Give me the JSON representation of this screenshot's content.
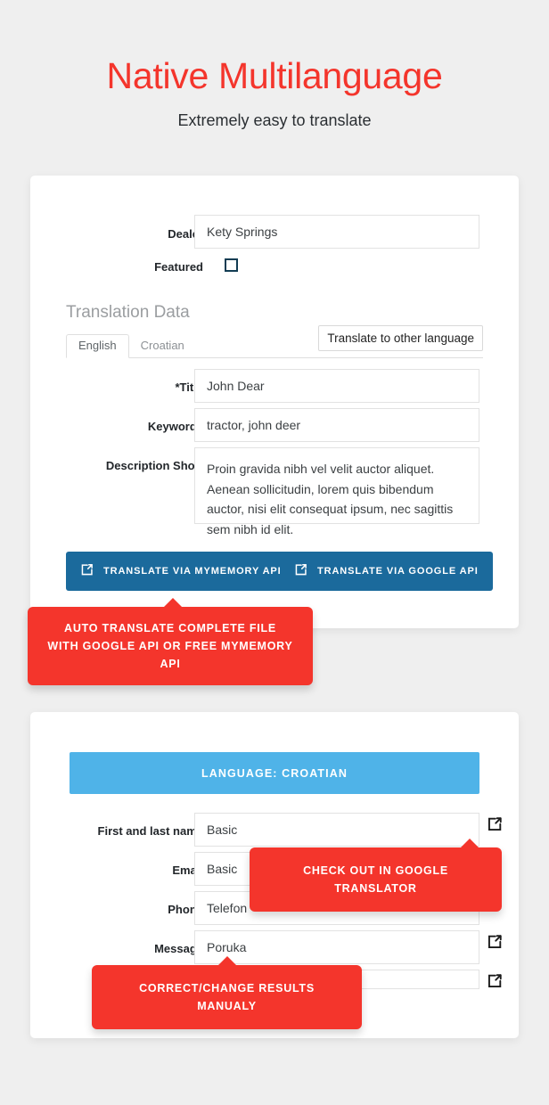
{
  "header": {
    "title": "Native Multilanguage",
    "subtitle": "Extremely easy to translate",
    "title_color": "#f4352c"
  },
  "colors": {
    "page_background": "#efefef",
    "accent_red": "#f4352c",
    "button_blue": "#1b6a9c",
    "banner_blue": "#4fb3e8",
    "card_white": "#ffffff"
  },
  "translation_card": {
    "fields": [
      {
        "label": "Dealer",
        "value": "Kety Springs",
        "type": "text"
      },
      {
        "label": "Featured",
        "value": "",
        "type": "checkbox",
        "checked": false
      }
    ],
    "section_heading": "Translation Data",
    "tabs": [
      {
        "label": "English",
        "active": true
      },
      {
        "label": "Croatian",
        "active": false
      }
    ],
    "translate_other_language_button": "Translate to other language",
    "translation_fields": [
      {
        "label": "*Title",
        "value": "John Dear"
      },
      {
        "label": "Keywords",
        "value": "tractor, john deer"
      },
      {
        "label": "Description Short",
        "value": "Proin gravida nibh vel velit auctor aliquet. Aenean sollicitudin, lorem quis bibendum auctor, nisi elit consequat ipsum, nec sagittis sem nibh id elit."
      }
    ],
    "buttons": [
      {
        "label": "TRANSLATE VIA MYMEMORY API",
        "icon": "external-link-icon"
      },
      {
        "label": "TRANSLATE VIA GOOGLE API",
        "icon": "external-link-icon"
      }
    ]
  },
  "callouts": {
    "auto_translate": {
      "line1": "AUTO TRANSLATE COMPLETE FILE",
      "line2": "WITH GOOGLE API OR FREE MYMEMORY API"
    },
    "check_google": "CHECK OUT IN GOOGLE TRANSLATOR",
    "correct_manually": "CORRECT/CHANGE RESULTS MANUALY"
  },
  "language_card": {
    "banner": "LANGUAGE: CROATIAN",
    "fields": [
      {
        "label": "First and last name",
        "value": "Basic",
        "icon": "external-link-icon"
      },
      {
        "label": "Email",
        "value": "Basic",
        "icon": "external-link-icon"
      },
      {
        "label": "Phone",
        "value": "Telefon",
        "icon": "external-link-icon"
      },
      {
        "label": "Message",
        "value": "Poruka",
        "icon": "external-link-icon"
      },
      {
        "label": "",
        "value": "",
        "icon": "external-link-icon"
      }
    ]
  }
}
